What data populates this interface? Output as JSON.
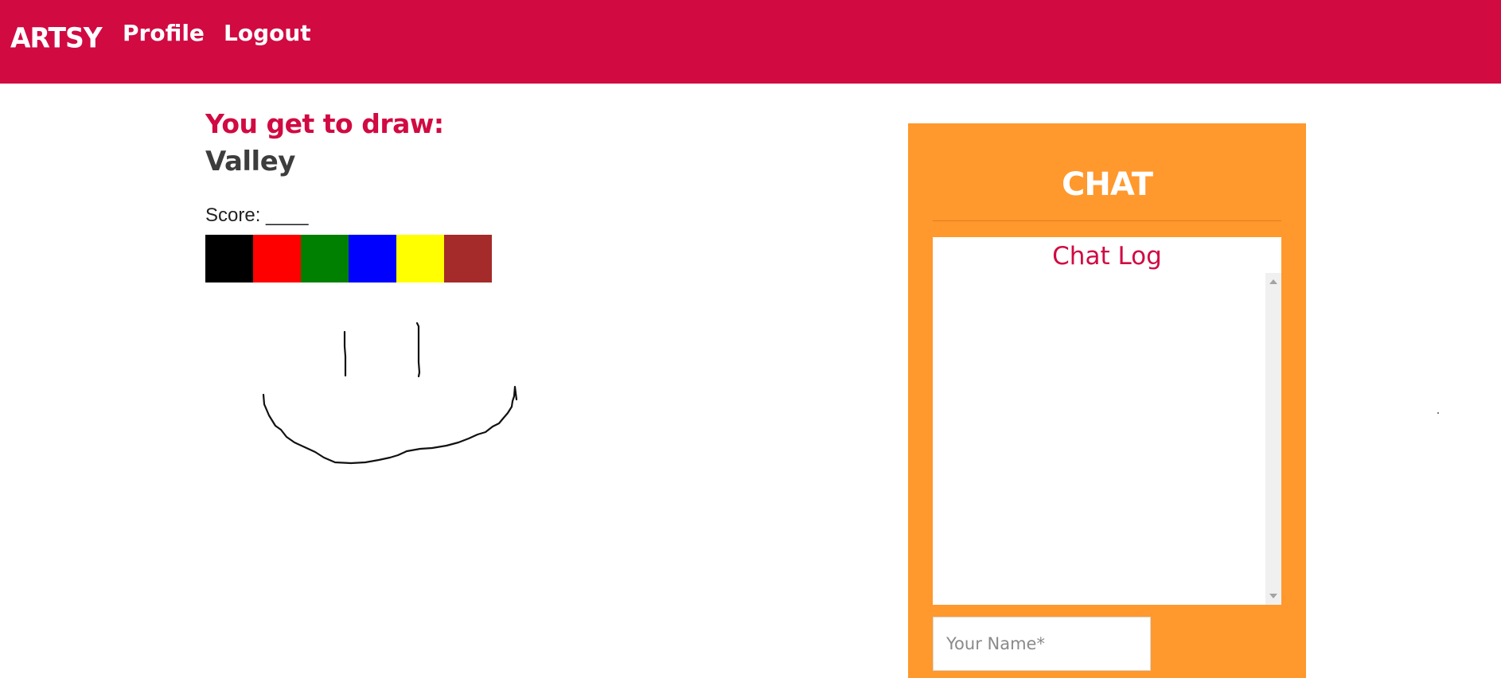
{
  "navbar": {
    "brand": "ARTSY",
    "links": [
      {
        "label": "Profile"
      },
      {
        "label": "Logout"
      }
    ],
    "background_color": "#d10a42"
  },
  "game": {
    "prompt_label": "You get to draw:",
    "word": "Valley",
    "score_label": "Score: ____",
    "palette": [
      {
        "name": "black",
        "color": "#000000"
      },
      {
        "name": "red",
        "color": "#ff0000"
      },
      {
        "name": "green",
        "color": "#008000"
      },
      {
        "name": "blue",
        "color": "#0000ff"
      },
      {
        "name": "yellow",
        "color": "#ffff00"
      },
      {
        "name": "brown",
        "color": "#a52a2a"
      }
    ]
  },
  "chat": {
    "title": "CHAT",
    "log_title": "Chat Log",
    "name_input": {
      "value": "",
      "placeholder": "Your Name*"
    },
    "panel_color": "#ff982d"
  }
}
